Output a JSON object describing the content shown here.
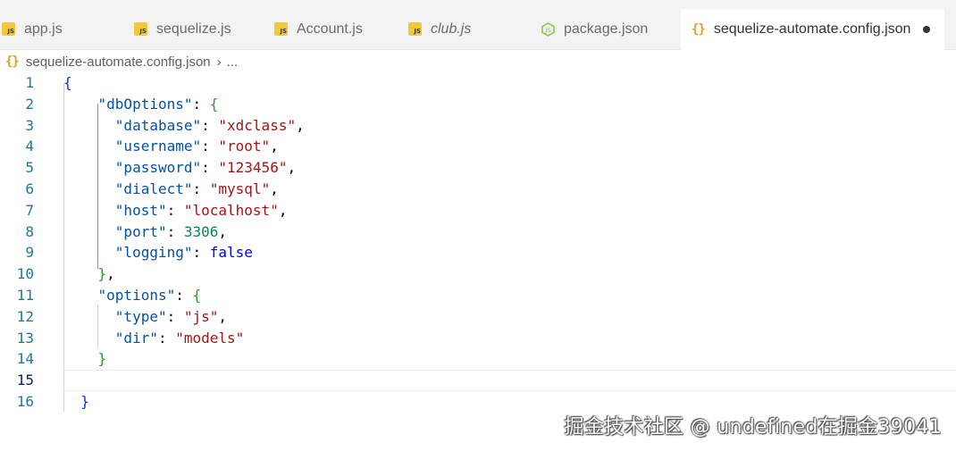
{
  "tabs": [
    {
      "label": "app.js",
      "icon": "js-icon"
    },
    {
      "label": "sequelize.js",
      "icon": "js-icon"
    },
    {
      "label": "Account.js",
      "icon": "js-icon"
    },
    {
      "label": "club.js",
      "icon": "js-icon"
    },
    {
      "label": "package.json",
      "icon": "nodejs-icon"
    },
    {
      "label": "sequelize-automate.config.json",
      "icon": "json-braces-icon",
      "active": true,
      "modified": true
    }
  ],
  "breadcrumb": {
    "file": "sequelize-automate.config.json",
    "ellipsis": "..."
  },
  "icons": {
    "js": "JS",
    "braces": "{}"
  },
  "gutter": {
    "lines": [
      "1",
      "2",
      "3",
      "4",
      "5",
      "6",
      "7",
      "8",
      "9",
      "10",
      "11",
      "12",
      "13",
      "14",
      "15",
      "16"
    ]
  },
  "code": {
    "db_options_key": "\"dbOptions\"",
    "database_key": "\"database\"",
    "database_val": "\"xdclass\"",
    "username_key": "\"username\"",
    "username_val": "\"root\"",
    "password_key": "\"password\"",
    "password_val": "\"123456\"",
    "dialect_key": "\"dialect\"",
    "dialect_val": "\"mysql\"",
    "host_key": "\"host\"",
    "host_val": "\"localhost\"",
    "port_key": "\"port\"",
    "port_val": "3306",
    "logging_key": "\"logging\"",
    "logging_val": "false",
    "options_key": "\"options\"",
    "type_key": "\"type\"",
    "type_val": "\"js\"",
    "dir_key": "\"dir\"",
    "dir_val": "\"models\""
  },
  "watermark": "掘金技术社区 @ undefined在掘金39041",
  "colors": {
    "key": "#0451a5",
    "string": "#a31515",
    "number": "#098658",
    "keyword": "#0000ff",
    "line_number": "#237893",
    "js_icon": "#f0c838",
    "json_icon": "#d8a21e"
  }
}
